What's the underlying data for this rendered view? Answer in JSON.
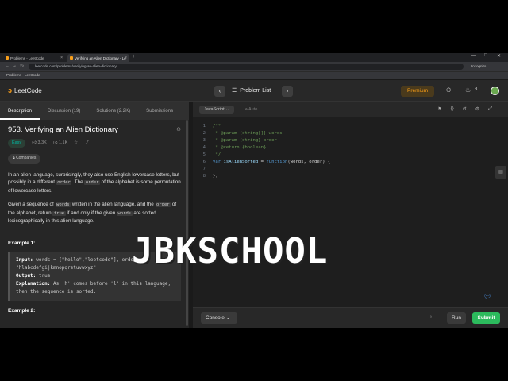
{
  "browser": {
    "tabs": [
      {
        "label": "Problems - LeetCode",
        "active": false
      },
      {
        "label": "Verifying an Alien Dictionary - Le",
        "active": true
      }
    ],
    "url": "leetcode.com/problems/verifying-an-alien-dictionary/",
    "profile": "Incognito",
    "bookmark": "Problems - LeetCode"
  },
  "header": {
    "logo": "LeetCode",
    "problem_list": "Problem List",
    "premium": "Premium",
    "streak": "3"
  },
  "left_tabs": [
    "Description",
    "Discussion (19)",
    "Solutions (2.2K)",
    "Submissions"
  ],
  "problem": {
    "title": "953. Verifying an Alien Dictionary",
    "difficulty": "Easy",
    "likes": "3.3K",
    "dislikes": "1.1K",
    "companies": "Companies",
    "p1a": "In an alien language, surprisingly, they also use English lowercase letters, but possibly in a different ",
    "p1code1": "order",
    "p1b": ". The ",
    "p1code2": "order",
    "p1c": " of the alphabet is some permutation of lowercase letters.",
    "p2a": "Given a sequence of ",
    "p2code1": "words",
    "p2b": " written in the alien language, and the ",
    "p2code2": "order",
    "p2c": " of the alphabet, return ",
    "p2code3": "true",
    "p2d": " if and only if the given ",
    "p2code4": "words",
    "p2e": " are sorted lexicographically in this alien language.",
    "example1_title": "Example 1:",
    "ex_input_label": "Input:",
    "ex_input": " words = [\"hello\",\"leetcode\"], order = \"hlabcdefgijkmnopqrstuvwxyz\"",
    "ex_output_label": "Output:",
    "ex_output": " true",
    "ex_expl_label": "Explanation:",
    "ex_expl": " As 'h' comes before 'l' in this language, then the sequence is sorted.",
    "example2_title": "Example 2:"
  },
  "editor": {
    "language": "JavaScript",
    "mode": "Auto",
    "lines": [
      {
        "n": "1",
        "parts": [
          {
            "t": "/**",
            "c": "c-comment"
          }
        ]
      },
      {
        "n": "2",
        "parts": [
          {
            "t": " * @param {string[]} words",
            "c": "c-comment"
          }
        ]
      },
      {
        "n": "3",
        "parts": [
          {
            "t": " * @param {string} order",
            "c": "c-comment"
          }
        ]
      },
      {
        "n": "4",
        "parts": [
          {
            "t": " * @return {boolean}",
            "c": "c-comment"
          }
        ]
      },
      {
        "n": "5",
        "parts": [
          {
            "t": " */",
            "c": "c-comment"
          }
        ]
      },
      {
        "n": "6",
        "parts": [
          {
            "t": "var ",
            "c": "c-kw"
          },
          {
            "t": "isAlienSorted",
            "c": "c-var"
          },
          {
            "t": " = ",
            "c": "c-plain"
          },
          {
            "t": "function",
            "c": "c-kw"
          },
          {
            "t": "(words, order) {",
            "c": "c-plain"
          }
        ]
      },
      {
        "n": "7",
        "parts": [
          {
            "t": "",
            "c": "c-plain"
          }
        ]
      },
      {
        "n": "8",
        "parts": [
          {
            "t": "};",
            "c": "c-plain"
          }
        ]
      }
    ]
  },
  "footer": {
    "console": "Console",
    "run": "Run",
    "submit": "Submit"
  },
  "watermark": "JBKSCHOOL",
  "colors": {
    "accent": "#ffa116",
    "easy": "#00b8a3",
    "submit": "#2cbb5d"
  }
}
